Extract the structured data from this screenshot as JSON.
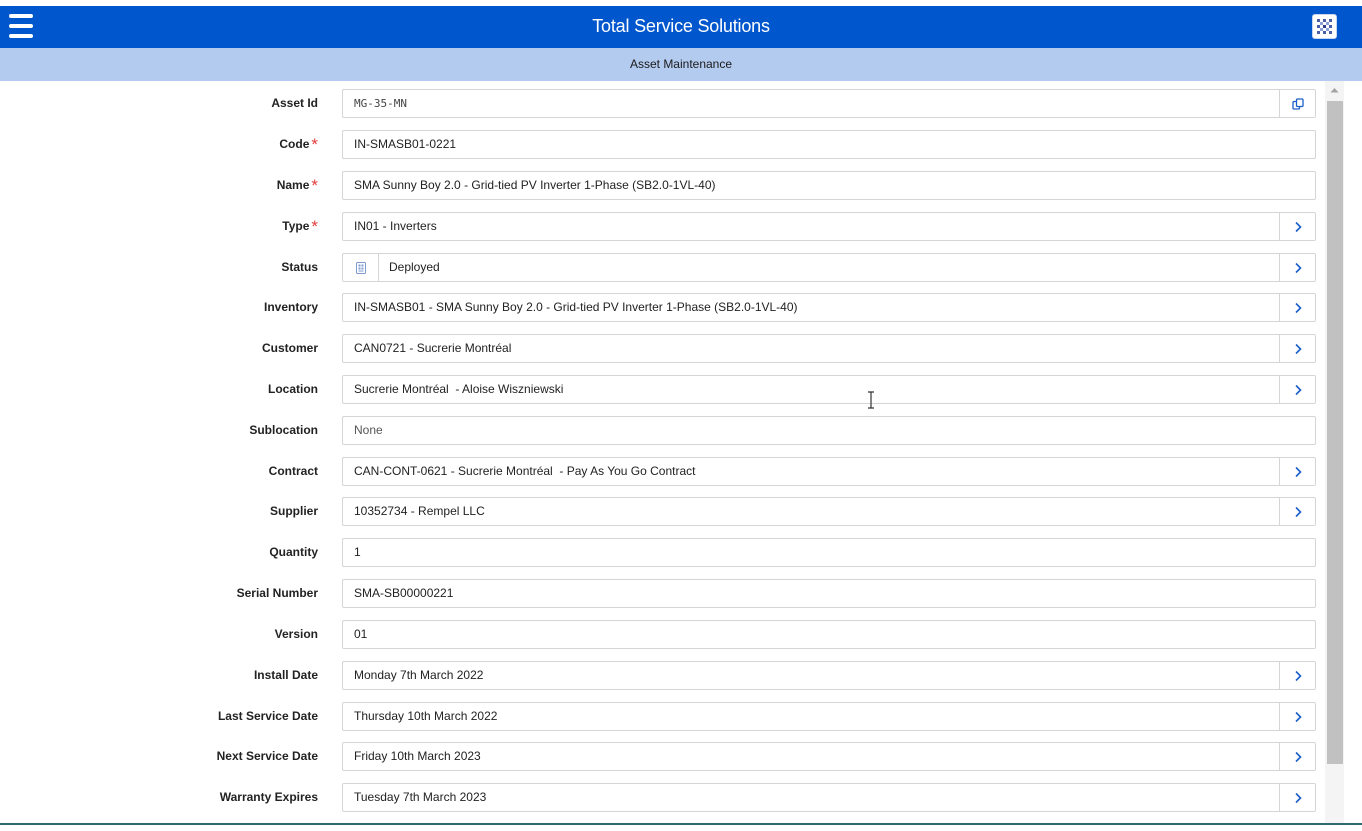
{
  "header": {
    "title": "Total Service Solutions",
    "menu_icon": "hamburger-menu-icon",
    "app_icon": "qr-grid-icon",
    "color": "#0056cc"
  },
  "subheader": {
    "title": "Asset Maintenance",
    "color": "#b4cbf0"
  },
  "form": {
    "asset_id": {
      "label": "Asset Id",
      "value": "MG-35-MN",
      "action_icon": "copy-icon"
    },
    "code": {
      "label": "Code",
      "value": "IN-SMASB01-0221",
      "required": "*"
    },
    "name": {
      "label": "Name",
      "value": "SMA Sunny Boy 2.0 - Grid-tied PV Inverter 1-Phase (SB2.0-1VL-40)",
      "required": "*"
    },
    "type": {
      "label": "Type",
      "value": "IN01 - Inverters",
      "required": "*",
      "action_icon": "chevron-right-icon"
    },
    "status": {
      "label": "Status",
      "value": "Deployed",
      "status_icon": "status-grid-icon",
      "action_icon": "chevron-right-icon"
    },
    "inventory": {
      "label": "Inventory",
      "value": "IN-SMASB01 - SMA Sunny Boy 2.0 - Grid-tied PV Inverter 1-Phase (SB2.0-1VL-40)",
      "action_icon": "chevron-right-icon"
    },
    "customer": {
      "label": "Customer",
      "value": "CAN0721 - Sucrerie Montréal",
      "action_icon": "chevron-right-icon"
    },
    "location": {
      "label": "Location",
      "value": "Sucrerie Montréal  - Aloise Wiszniewski",
      "action_icon": "chevron-right-icon"
    },
    "sublocation": {
      "label": "Sublocation",
      "value": "None"
    },
    "contract": {
      "label": "Contract",
      "value": "CAN-CONT-0621 - Sucrerie Montréal  - Pay As You Go Contract",
      "action_icon": "chevron-right-icon"
    },
    "supplier": {
      "label": "Supplier",
      "value": "10352734 - Rempel LLC",
      "action_icon": "chevron-right-icon"
    },
    "quantity": {
      "label": "Quantity",
      "value": "1"
    },
    "serial_number": {
      "label": "Serial Number",
      "value": "SMA-SB00000221"
    },
    "version": {
      "label": "Version",
      "value": "01"
    },
    "install_date": {
      "label": "Install Date",
      "value": "Monday 7th March 2022",
      "action_icon": "chevron-right-icon"
    },
    "last_service_date": {
      "label": "Last Service Date",
      "value": "Thursday 10th March 2022",
      "action_icon": "chevron-right-icon"
    },
    "next_service_date": {
      "label": "Next Service Date",
      "value": "Friday 10th March 2023",
      "action_icon": "chevron-right-icon"
    },
    "warranty_expires": {
      "label": "Warranty Expires",
      "value": "Tuesday 7th March 2023",
      "action_icon": "chevron-right-icon"
    }
  },
  "colors": {
    "accent": "#0056cc",
    "required": "#e23b3b",
    "chevron": "#1a5fc8"
  }
}
